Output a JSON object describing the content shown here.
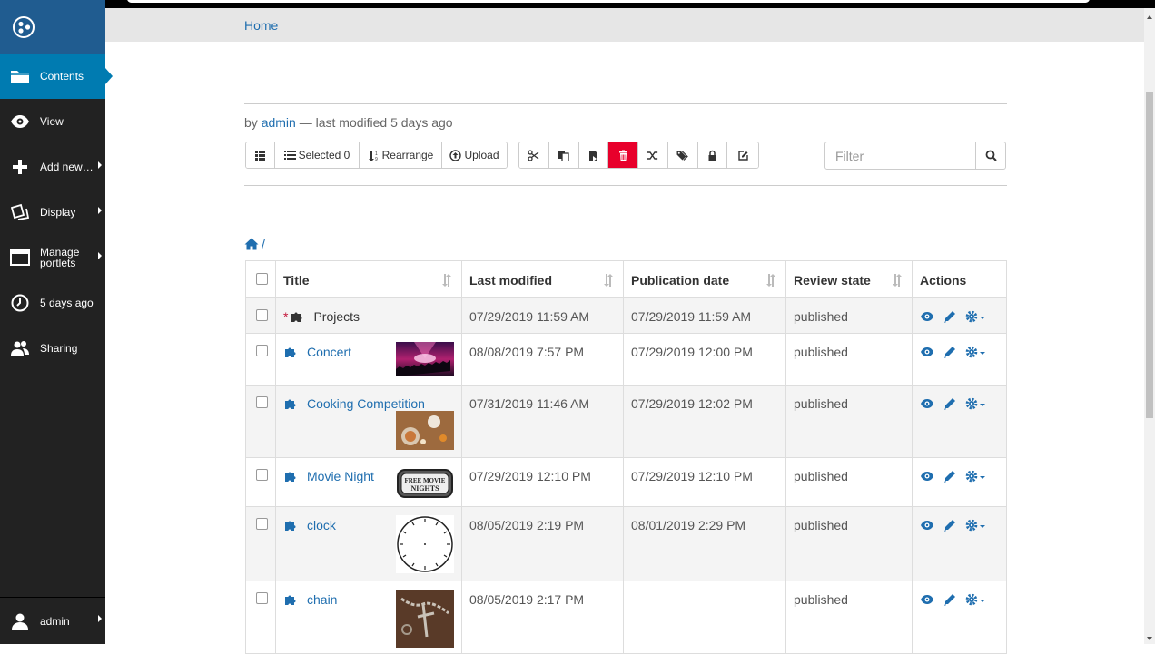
{
  "toolbar": {
    "items": [
      {
        "label": "Contents",
        "icon": "folder-icon"
      },
      {
        "label": "View",
        "icon": "eye-icon"
      },
      {
        "label": "Add new…",
        "icon": "plus-icon"
      },
      {
        "label": "Display",
        "icon": "display-icon"
      },
      {
        "label": "Manage portlets",
        "icon": "window-icon"
      },
      {
        "label": "5 days ago",
        "icon": "clock-icon"
      },
      {
        "label": "Sharing",
        "icon": "users-icon"
      }
    ],
    "user": "admin"
  },
  "breadcrumb": {
    "home": "Home"
  },
  "byline": {
    "prefix": "by",
    "author": "admin",
    "suffix": "— last modified 5 days ago"
  },
  "buttons": {
    "selected": "Selected 0",
    "rearrange": "Rearrange",
    "upload": "Upload"
  },
  "filter": {
    "placeholder": "Filter"
  },
  "path": {
    "separator": "/"
  },
  "table": {
    "headers": {
      "title": "Title",
      "modified": "Last modified",
      "published": "Publication date",
      "state": "Review state",
      "actions": "Actions"
    },
    "rows": [
      {
        "title": "Projects",
        "modified": "07/29/2019 11:59 AM",
        "published": "07/29/2019 11:59 AM",
        "state": "published",
        "required": "*"
      },
      {
        "title": "Concert",
        "modified": "08/08/2019 7:57 PM",
        "published": "07/29/2019 12:00 PM",
        "state": "published",
        "thumb": "concert-thumbnail"
      },
      {
        "title": "Cooking Competition",
        "modified": "07/31/2019 11:46 AM",
        "published": "07/29/2019 12:02 PM",
        "state": "published",
        "thumb": "cooking-thumbnail"
      },
      {
        "title": "Movie Night",
        "modified": "07/29/2019 12:10 PM",
        "published": "07/29/2019 12:10 PM",
        "state": "published",
        "thumb": "movie-night-thumbnail",
        "thumb_text": "FREE MOVIE NIGHTS"
      },
      {
        "title": "clock",
        "modified": "08/05/2019 2:19 PM",
        "published": "08/01/2019 2:29 PM",
        "state": "published",
        "thumb": "clock-thumbnail"
      },
      {
        "title": "chain",
        "modified": "08/05/2019 2:17 PM",
        "published": "",
        "state": "published",
        "thumb": "chain-thumbnail"
      }
    ]
  },
  "colors": {
    "toolbar_bg": "#222222",
    "toolbar_active": "#007bb1",
    "link": "#1f6eaf",
    "danger": "#e8002b"
  }
}
